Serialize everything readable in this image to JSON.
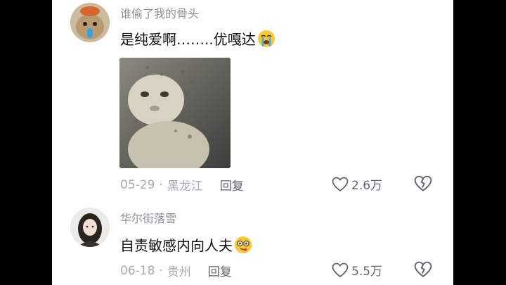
{
  "comments": [
    {
      "username": "谁偷了我的骨头",
      "text": "是纯爱啊……..优嘎达",
      "emoji": "crying-face-emoji",
      "date": "05-29",
      "location": "黑龙江",
      "reply_label": "回复",
      "likes": "2.6万"
    },
    {
      "username": "华尔街落雪",
      "text": "自责敏感内向人夫",
      "emoji": "woozy-face-emoji",
      "date": "06-18",
      "location": "贵州",
      "reply_label": "回复",
      "likes": "5.5万"
    }
  ],
  "meta_separator": "·",
  "colors": {
    "background": "#000000",
    "panel": "#ffffff",
    "username": "#8c8f96",
    "meta": "#a6a9b0"
  }
}
